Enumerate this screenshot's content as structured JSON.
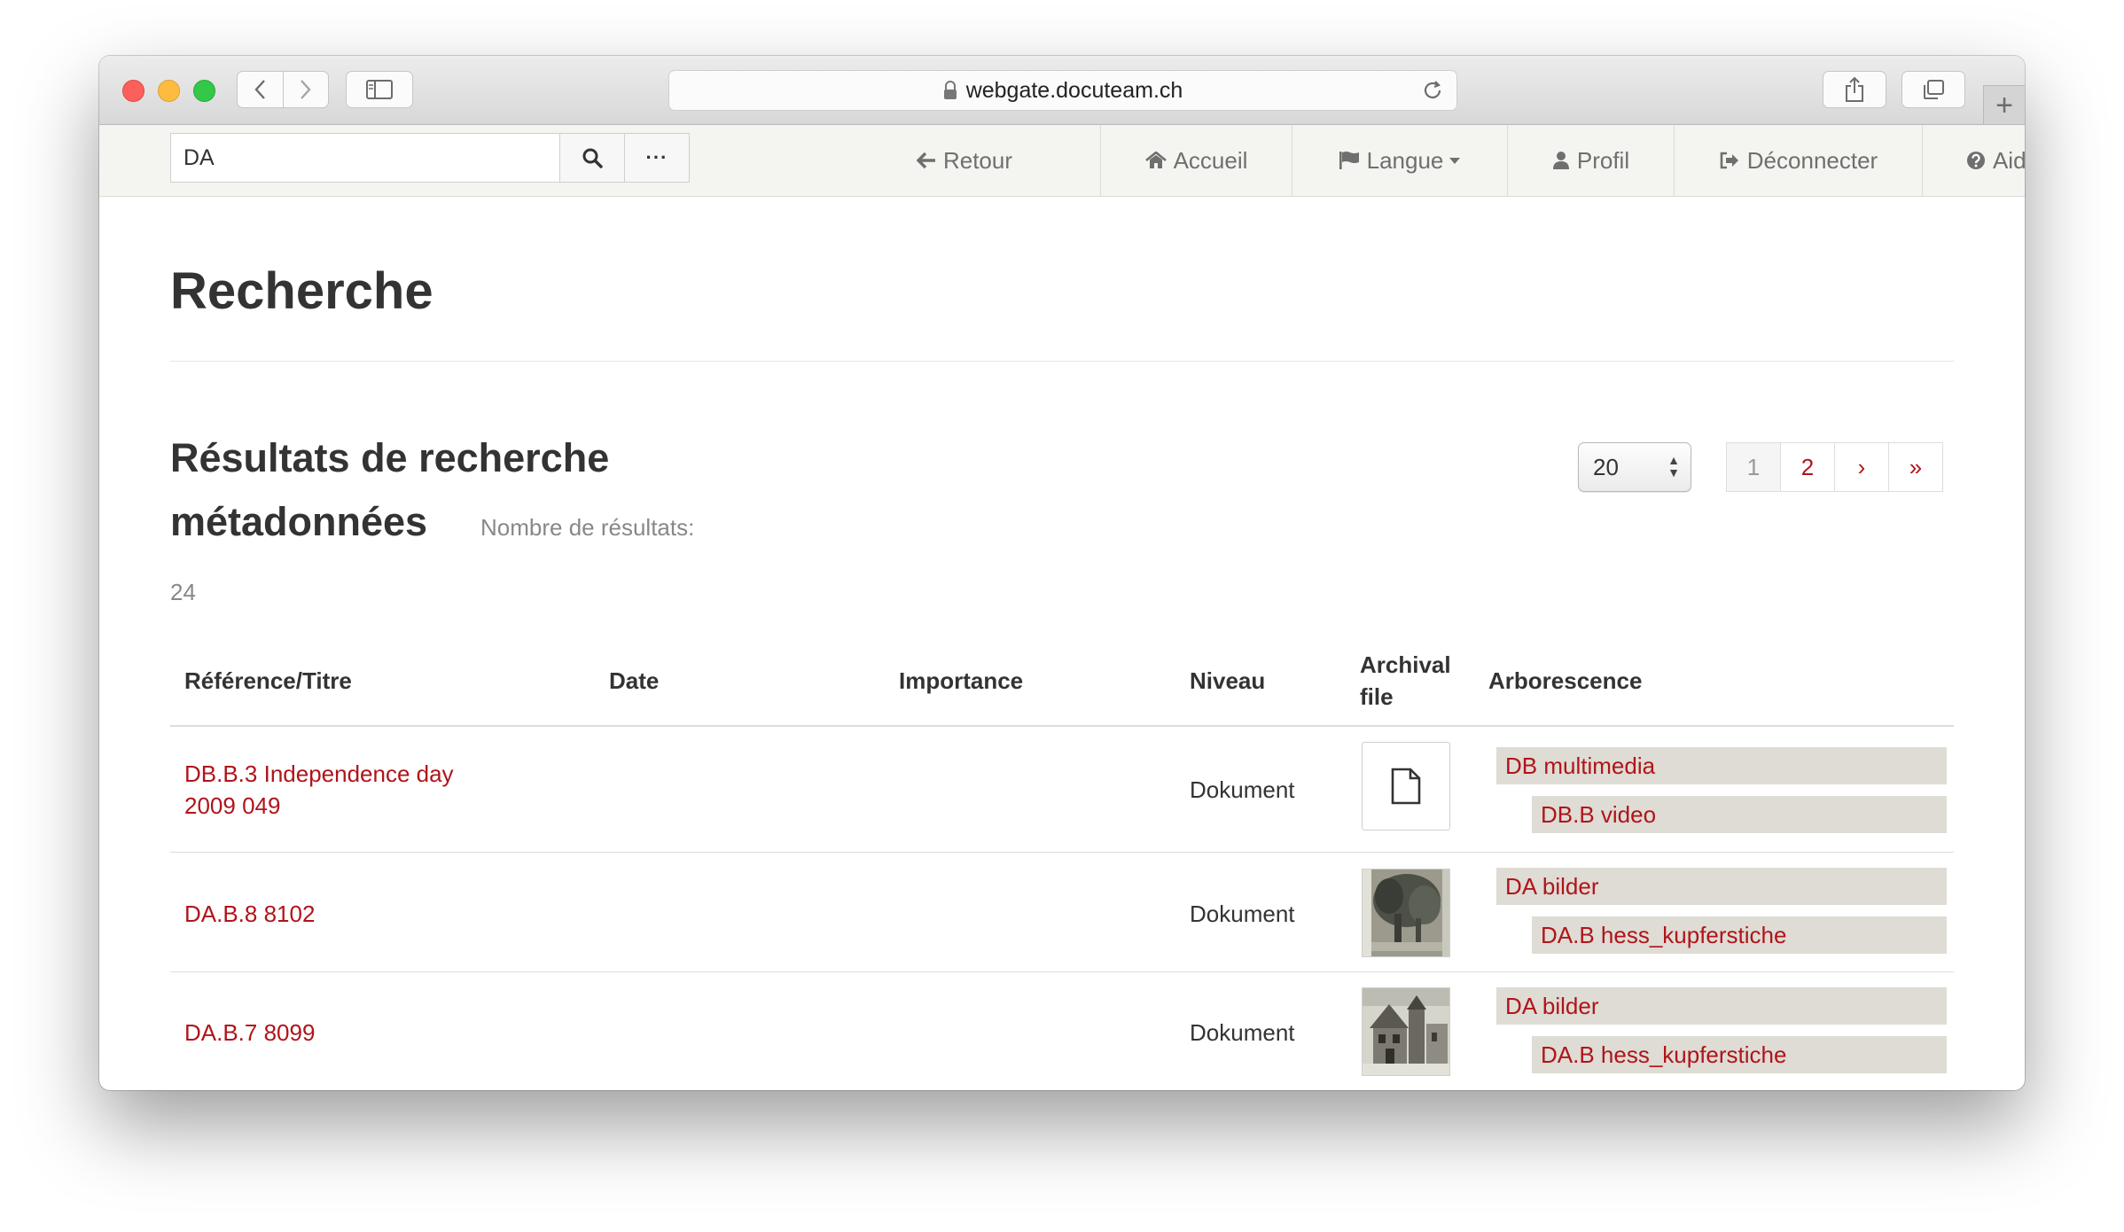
{
  "browser": {
    "url": "webgate.docuteam.ch"
  },
  "navbar": {
    "search_value": "DA",
    "more_label": "···",
    "menu": [
      {
        "label": "Retour",
        "icon": "arrow-left-icon"
      },
      {
        "label": "Accueil",
        "icon": "home-icon"
      },
      {
        "label": "Langue",
        "icon": "flag-icon"
      },
      {
        "label": "Profil",
        "icon": "user-icon"
      },
      {
        "label": "Déconnecter",
        "icon": "sign-out-icon"
      },
      {
        "label": "Aide",
        "icon": "question-circle-icon"
      }
    ]
  },
  "page": {
    "title": "Recherche",
    "results_title": "Résultats de recherche métadonnées",
    "results_label": "Nombre de résultats:",
    "results_count": "24"
  },
  "pagination": {
    "per_page": "20",
    "pages": [
      "1",
      "2",
      "›",
      "»"
    ]
  },
  "table": {
    "headers": {
      "ref": "Référence/Titre",
      "date": "Date",
      "importance": "Importance",
      "niveau": "Niveau",
      "archival": "Archival file",
      "arbo": "Arborescence"
    },
    "rows": [
      {
        "ref": "DB.B.3 Independence day 2009 049",
        "niveau": "Dokument",
        "thumb": "document-icon",
        "tree": [
          "DB multimedia",
          "DB.B video"
        ]
      },
      {
        "ref": "DA.B.8 8102",
        "niveau": "Dokument",
        "thumb": "engraving-park",
        "tree": [
          "DA bilder",
          "DA.B hess_kupferstiche"
        ]
      },
      {
        "ref": "DA.B.7 8099",
        "niveau": "Dokument",
        "thumb": "engraving-house",
        "tree": [
          "DA bilder",
          "DA.B hess_kupferstiche"
        ]
      }
    ]
  },
  "colors": {
    "link": "#b0141a",
    "tree_bg": "#dedcd4",
    "navbar_bg": "#f4f4f1"
  }
}
